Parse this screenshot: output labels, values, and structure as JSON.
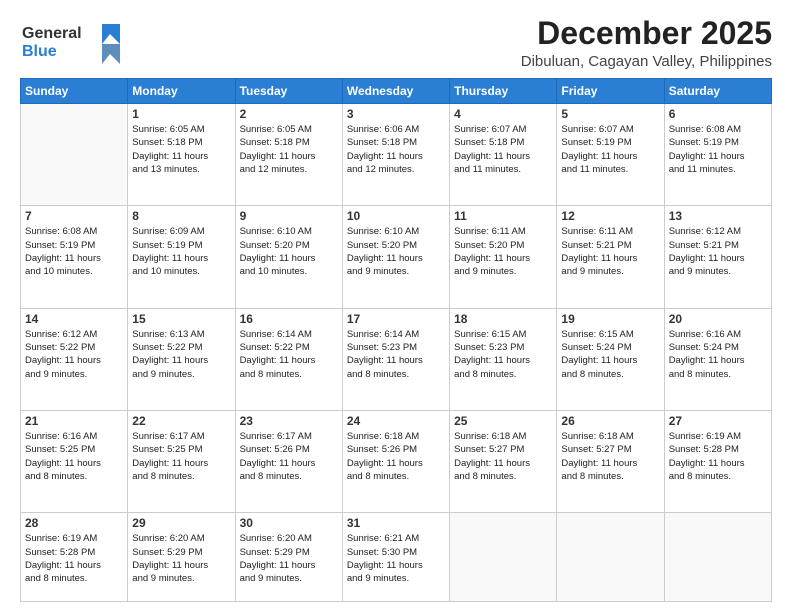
{
  "header": {
    "logo_line1": "General",
    "logo_line2": "Blue",
    "month_title": "December 2025",
    "location": "Dibuluan, Cagayan Valley, Philippines"
  },
  "days_of_week": [
    "Sunday",
    "Monday",
    "Tuesday",
    "Wednesday",
    "Thursday",
    "Friday",
    "Saturday"
  ],
  "weeks": [
    [
      {
        "day": "",
        "info": ""
      },
      {
        "day": "1",
        "info": "Sunrise: 6:05 AM\nSunset: 5:18 PM\nDaylight: 11 hours\nand 13 minutes."
      },
      {
        "day": "2",
        "info": "Sunrise: 6:05 AM\nSunset: 5:18 PM\nDaylight: 11 hours\nand 12 minutes."
      },
      {
        "day": "3",
        "info": "Sunrise: 6:06 AM\nSunset: 5:18 PM\nDaylight: 11 hours\nand 12 minutes."
      },
      {
        "day": "4",
        "info": "Sunrise: 6:07 AM\nSunset: 5:18 PM\nDaylight: 11 hours\nand 11 minutes."
      },
      {
        "day": "5",
        "info": "Sunrise: 6:07 AM\nSunset: 5:19 PM\nDaylight: 11 hours\nand 11 minutes."
      },
      {
        "day": "6",
        "info": "Sunrise: 6:08 AM\nSunset: 5:19 PM\nDaylight: 11 hours\nand 11 minutes."
      }
    ],
    [
      {
        "day": "7",
        "info": "Sunrise: 6:08 AM\nSunset: 5:19 PM\nDaylight: 11 hours\nand 10 minutes."
      },
      {
        "day": "8",
        "info": "Sunrise: 6:09 AM\nSunset: 5:19 PM\nDaylight: 11 hours\nand 10 minutes."
      },
      {
        "day": "9",
        "info": "Sunrise: 6:10 AM\nSunset: 5:20 PM\nDaylight: 11 hours\nand 10 minutes."
      },
      {
        "day": "10",
        "info": "Sunrise: 6:10 AM\nSunset: 5:20 PM\nDaylight: 11 hours\nand 9 minutes."
      },
      {
        "day": "11",
        "info": "Sunrise: 6:11 AM\nSunset: 5:20 PM\nDaylight: 11 hours\nand 9 minutes."
      },
      {
        "day": "12",
        "info": "Sunrise: 6:11 AM\nSunset: 5:21 PM\nDaylight: 11 hours\nand 9 minutes."
      },
      {
        "day": "13",
        "info": "Sunrise: 6:12 AM\nSunset: 5:21 PM\nDaylight: 11 hours\nand 9 minutes."
      }
    ],
    [
      {
        "day": "14",
        "info": "Sunrise: 6:12 AM\nSunset: 5:22 PM\nDaylight: 11 hours\nand 9 minutes."
      },
      {
        "day": "15",
        "info": "Sunrise: 6:13 AM\nSunset: 5:22 PM\nDaylight: 11 hours\nand 9 minutes."
      },
      {
        "day": "16",
        "info": "Sunrise: 6:14 AM\nSunset: 5:22 PM\nDaylight: 11 hours\nand 8 minutes."
      },
      {
        "day": "17",
        "info": "Sunrise: 6:14 AM\nSunset: 5:23 PM\nDaylight: 11 hours\nand 8 minutes."
      },
      {
        "day": "18",
        "info": "Sunrise: 6:15 AM\nSunset: 5:23 PM\nDaylight: 11 hours\nand 8 minutes."
      },
      {
        "day": "19",
        "info": "Sunrise: 6:15 AM\nSunset: 5:24 PM\nDaylight: 11 hours\nand 8 minutes."
      },
      {
        "day": "20",
        "info": "Sunrise: 6:16 AM\nSunset: 5:24 PM\nDaylight: 11 hours\nand 8 minutes."
      }
    ],
    [
      {
        "day": "21",
        "info": "Sunrise: 6:16 AM\nSunset: 5:25 PM\nDaylight: 11 hours\nand 8 minutes."
      },
      {
        "day": "22",
        "info": "Sunrise: 6:17 AM\nSunset: 5:25 PM\nDaylight: 11 hours\nand 8 minutes."
      },
      {
        "day": "23",
        "info": "Sunrise: 6:17 AM\nSunset: 5:26 PM\nDaylight: 11 hours\nand 8 minutes."
      },
      {
        "day": "24",
        "info": "Sunrise: 6:18 AM\nSunset: 5:26 PM\nDaylight: 11 hours\nand 8 minutes."
      },
      {
        "day": "25",
        "info": "Sunrise: 6:18 AM\nSunset: 5:27 PM\nDaylight: 11 hours\nand 8 minutes."
      },
      {
        "day": "26",
        "info": "Sunrise: 6:18 AM\nSunset: 5:27 PM\nDaylight: 11 hours\nand 8 minutes."
      },
      {
        "day": "27",
        "info": "Sunrise: 6:19 AM\nSunset: 5:28 PM\nDaylight: 11 hours\nand 8 minutes."
      }
    ],
    [
      {
        "day": "28",
        "info": "Sunrise: 6:19 AM\nSunset: 5:28 PM\nDaylight: 11 hours\nand 8 minutes."
      },
      {
        "day": "29",
        "info": "Sunrise: 6:20 AM\nSunset: 5:29 PM\nDaylight: 11 hours\nand 9 minutes."
      },
      {
        "day": "30",
        "info": "Sunrise: 6:20 AM\nSunset: 5:29 PM\nDaylight: 11 hours\nand 9 minutes."
      },
      {
        "day": "31",
        "info": "Sunrise: 6:21 AM\nSunset: 5:30 PM\nDaylight: 11 hours\nand 9 minutes."
      },
      {
        "day": "",
        "info": ""
      },
      {
        "day": "",
        "info": ""
      },
      {
        "day": "",
        "info": ""
      }
    ]
  ]
}
